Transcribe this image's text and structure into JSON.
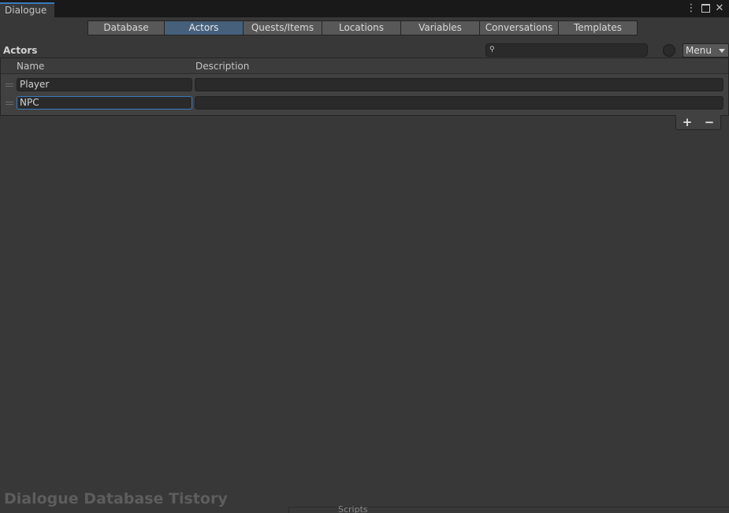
{
  "window": {
    "tab_label": "Dialogue",
    "controls": {
      "more_icon": "⋮",
      "close_icon": "✕"
    }
  },
  "toolbar": {
    "tabs": [
      {
        "label": "Database",
        "active": false
      },
      {
        "label": "Actors",
        "active": true
      },
      {
        "label": "Quests/Items",
        "active": false
      },
      {
        "label": "Locations",
        "active": false
      },
      {
        "label": "Variables",
        "active": false
      },
      {
        "label": "Conversations",
        "active": false
      },
      {
        "label": "Templates",
        "active": false
      }
    ]
  },
  "section": {
    "title": "Actors",
    "search_value": "",
    "menu_label": "Menu"
  },
  "list": {
    "columns": {
      "name": "Name",
      "description": "Description"
    },
    "rows": [
      {
        "name": "Player",
        "description": "",
        "focused": false
      },
      {
        "name": "NPC",
        "description": "",
        "focused": true
      }
    ],
    "add_label": "+",
    "remove_label": "−"
  },
  "watermark": "Dialogue Database Tistory",
  "bottom_strip": {
    "label": "Scripts"
  },
  "colors": {
    "accent": "#3a79bb",
    "active_tab": "#46607c",
    "background": "#383838"
  }
}
